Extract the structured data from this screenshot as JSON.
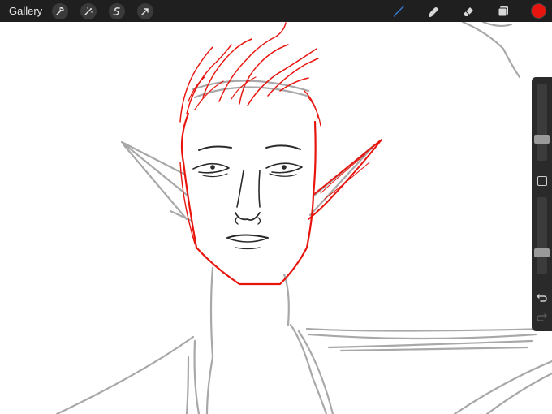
{
  "toolbar": {
    "gallery_label": "Gallery",
    "left_tools": [
      {
        "name": "actions-icon"
      },
      {
        "name": "adjustments-icon"
      },
      {
        "name": "selection-icon"
      },
      {
        "name": "transform-icon"
      }
    ],
    "right_tools": [
      {
        "name": "brush-icon",
        "active": true
      },
      {
        "name": "smudge-icon"
      },
      {
        "name": "eraser-icon"
      },
      {
        "name": "layers-icon"
      }
    ],
    "current_color": "#e8150f"
  },
  "colors": {
    "toolbar_bg": "#1f1f1f",
    "active_tool": "#3a7bd5",
    "sketch_gray": "#a8a8a8",
    "sketch_red": "#e8150f",
    "line_dark": "#2a2a2a"
  },
  "sidebar": {
    "brush_size_level": 0.25,
    "opacity_level": 0.25
  }
}
